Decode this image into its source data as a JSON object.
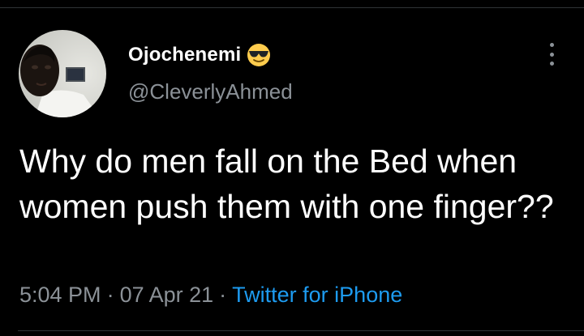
{
  "tweet": {
    "author": {
      "display_name": "Ojochenemi",
      "name_emoji_icon": "smiling-face-with-sunglasses",
      "handle": "@CleverlyAhmed"
    },
    "text": "Why do men fall on the Bed when women push them with one finger??",
    "time": "5:04 PM",
    "date": "07 Apr 21",
    "separator": "·",
    "source": "Twitter for iPhone"
  },
  "colors": {
    "background": "#000000",
    "primary_text": "#ffffff",
    "secondary_text": "#8b9197",
    "link": "#1d9bf0",
    "divider": "#2f3336"
  }
}
